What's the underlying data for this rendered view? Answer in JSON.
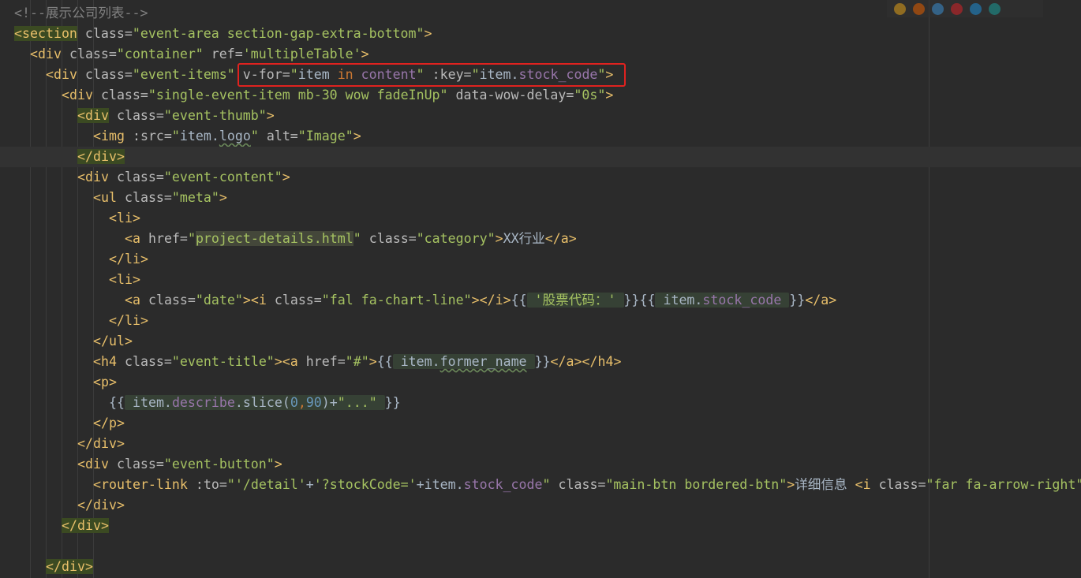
{
  "browser_icons": [
    {
      "name": "chrome-icon",
      "color": "#e3a21a"
    },
    {
      "name": "firefox-icon",
      "color": "#e66000"
    },
    {
      "name": "safari-icon",
      "color": "#3d8fd1"
    },
    {
      "name": "opera-icon",
      "color": "#d9252a"
    },
    {
      "name": "internet-explorer-icon",
      "color": "#1f8fd6"
    },
    {
      "name": "edge-icon",
      "color": "#1b9e9a"
    }
  ],
  "code": {
    "l1": {
      "comment": "<!--展示公司列表-->"
    },
    "l2": {
      "open": "<section",
      "attr": " class=",
      "val": "\"event-area section-gap-extra-bottom\"",
      "close": ">"
    },
    "l3": {
      "open": "<div",
      "attr1": " class=",
      "val1": "\"container\"",
      "attr2": " ref=",
      "val2": "'multipleTable'",
      "close": ">"
    },
    "l4": {
      "open": "<div",
      "attr1": " class=",
      "val1": "\"event-items\"",
      "sp": " ",
      "vfor": "v-for=",
      "q1": "\"",
      "item": "item ",
      "in": "in",
      "content": " content",
      "q2": "\"",
      "key": " :key=",
      "q3": "\"",
      "item2": "item.",
      "stock": "stock_code",
      "q4": "\"",
      "close": ">"
    },
    "l5": {
      "open": "<div",
      "attr1": " class=",
      "val1": "\"single-event-item mb-30 wow fadeInUp\"",
      "attr2": " data-wow-delay=",
      "val2": "\"0s\"",
      "close": ">"
    },
    "l6": {
      "open": "<div",
      "attr": " class=",
      "val": "\"event-thumb\"",
      "close": ">"
    },
    "l7": {
      "open": "<img",
      "attr1": " :src=",
      "q1": "\"",
      "item": "item.",
      "logo": "logo",
      "q2": "\"",
      "attr2": " alt=",
      "val2": "\"Image\"",
      "close": ">"
    },
    "l8": {
      "tag": "</div>"
    },
    "l9": {
      "open": "<div",
      "attr": " class=",
      "val": "\"event-content\"",
      "close": ">"
    },
    "l10": {
      "open": "<ul",
      "attr": " class=",
      "val": "\"meta\"",
      "close": ">"
    },
    "l11": {
      "tag": "<li>"
    },
    "l12": {
      "open": "<a",
      "attr1": " href=",
      "q1": "\"",
      "href": "project-details.html",
      "q2": "\"",
      "attr2": " class=",
      "val2": "\"category\"",
      "gt": ">",
      "text": "XX行业",
      "close": "</a>"
    },
    "l13": {
      "tag": "</li>"
    },
    "l14": {
      "tag": "<li>"
    },
    "l15": {
      "open": "<a",
      "attr1": " class=",
      "val1": "\"date\"",
      "gt": ">",
      "iopen": "<i",
      "attr2": " class=",
      "val2": "\"fal fa-chart-line\"",
      "iclose": "></i>",
      "m1": "{{",
      "s1": " '股票代码：' ",
      "m2": "}}",
      "m3": "{{",
      "e1": " item.",
      "e2": "stock_code",
      "e3": " ",
      "m4": "}}",
      "close": "</a>"
    },
    "l16": {
      "tag": "</li>"
    },
    "l17": {
      "tag": "</ul>"
    },
    "l18": {
      "open": "<h4",
      "attr1": " class=",
      "val1": "\"event-title\"",
      "gt": ">",
      "aopen": "<a",
      "attr2": " href=",
      "val2": "\"#\"",
      "gt2": ">",
      "m1": "{{",
      "e1": " item.",
      "e2": "former_name",
      "e3": " ",
      "m2": "}}",
      "close": "</a></h4>"
    },
    "l19": {
      "tag": "<p>"
    },
    "l20": {
      "m1": "{{",
      "e1": " item.",
      "e2": "describe",
      "e3": ".slice(",
      "n1": "0",
      "comma": ",",
      "n2": "90",
      "e4": ")+",
      "s": "\"...\"",
      "e5": " ",
      "m2": "}}"
    },
    "l21": {
      "tag": "</p>"
    },
    "l22": {
      "tag": "</div>"
    },
    "l23": {
      "open": "<div",
      "attr": " class=",
      "val": "\"event-button\"",
      "close": ">"
    },
    "l24": {
      "open": "<router-link",
      "attr1": " :to=",
      "q1": "\"",
      "s1": "'/detail'",
      "plus1": "+",
      "s2": "'?stockCode='",
      "plus2": "+item.",
      "e2": "stock_code",
      "q2": "\"",
      "attr2": " class=",
      "val2": "\"main-btn bordered-btn\"",
      "gt": ">",
      "text": "详细信息 ",
      "iopen": "<i",
      "attr3": " class=",
      "val3": "\"far fa-arrow-right\""
    },
    "l25": {
      "tag": "</div>"
    },
    "l26": {
      "tag": "</div>"
    },
    "l28": {
      "tag": "</div>"
    }
  }
}
